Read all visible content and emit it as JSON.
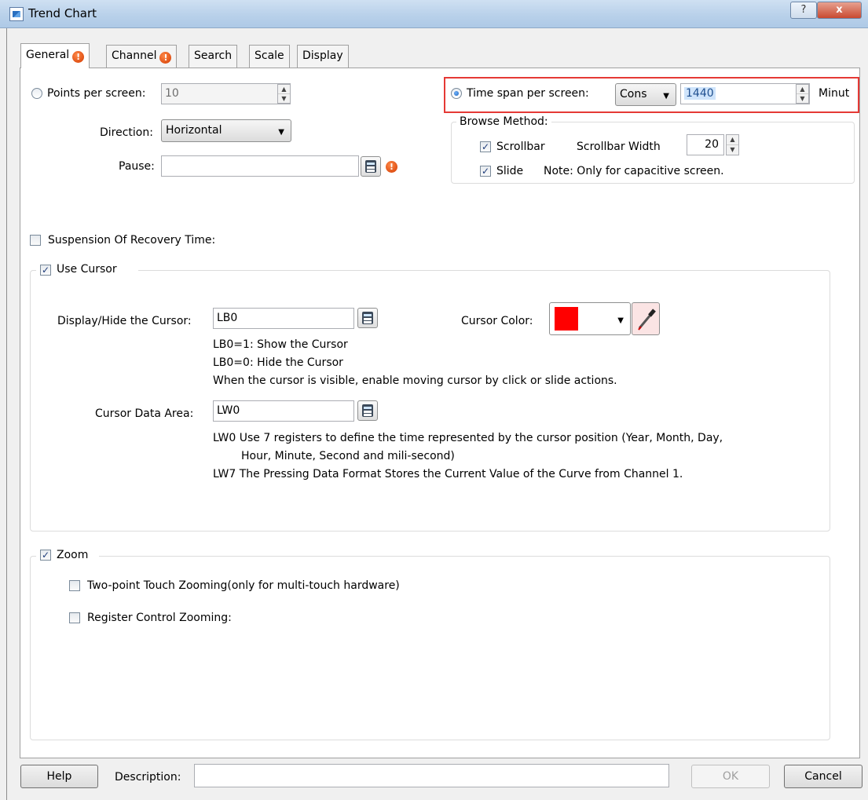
{
  "window": {
    "title": "Trend Chart",
    "help_glyph": "?",
    "close_glyph": "x"
  },
  "tabs": [
    {
      "label": "General",
      "warning": true,
      "active": true
    },
    {
      "label": "Channel",
      "warning": true,
      "active": false
    },
    {
      "label": "Search",
      "warning": false,
      "active": false
    },
    {
      "label": "Scale",
      "warning": false,
      "active": false
    },
    {
      "label": "Display",
      "warning": false,
      "active": false
    }
  ],
  "warning_glyph": "!",
  "general": {
    "points_per_screen": {
      "label": "Points per screen:",
      "value": "10",
      "selected": false
    },
    "direction": {
      "label": "Direction:",
      "value": "Horizontal"
    },
    "pause": {
      "label": "Pause:",
      "value": ""
    },
    "time_span": {
      "label": "Time span per screen:",
      "mode": "Cons",
      "value": "1440",
      "unit": "Minut",
      "selected": true
    },
    "browse_method": {
      "label": "Browse Method:",
      "scrollbar": {
        "label": "Scrollbar",
        "checked": true
      },
      "scrollbar_width": {
        "label": "Scrollbar Width",
        "value": "20"
      },
      "slide": {
        "label": "Slide",
        "checked": true
      },
      "note": "Note: Only for capacitive screen."
    },
    "suspension": {
      "label": "Suspension Of Recovery Time:",
      "checked": false
    },
    "use_cursor": {
      "label": "Use Cursor",
      "checked": true,
      "display_hide": {
        "label": "Display/Hide the Cursor:",
        "value": "LB0"
      },
      "help_lines": [
        "LB0=1: Show the Cursor",
        "LB0=0: Hide the Cursor",
        "When the cursor is visible, enable moving cursor by click or slide actions."
      ],
      "cursor_color": {
        "label": "Cursor Color:",
        "color": "#ff0000"
      },
      "data_area": {
        "label": "Cursor Data Area:",
        "value": "LW0"
      },
      "data_help": [
        "LW0 Use 7 registers to define the time represented by the cursor position (Year, Month, Day,",
        "Hour, Minute, Second and mili-second)",
        "LW7 The Pressing Data Format Stores the Current Value of the Curve from Channel 1."
      ]
    },
    "zoom": {
      "label": "Zoom",
      "checked": true,
      "two_point": {
        "label": "Two-point Touch Zooming(only for multi-touch hardware)",
        "checked": false
      },
      "register_control": {
        "label": "Register Control Zooming:",
        "checked": false
      }
    }
  },
  "footer": {
    "help": "Help",
    "description_label": "Description:",
    "description_value": "",
    "ok": "OK",
    "cancel": "Cancel"
  },
  "colors": {
    "highlight_box": "#e53935",
    "cursor_color": "#ff0000"
  }
}
